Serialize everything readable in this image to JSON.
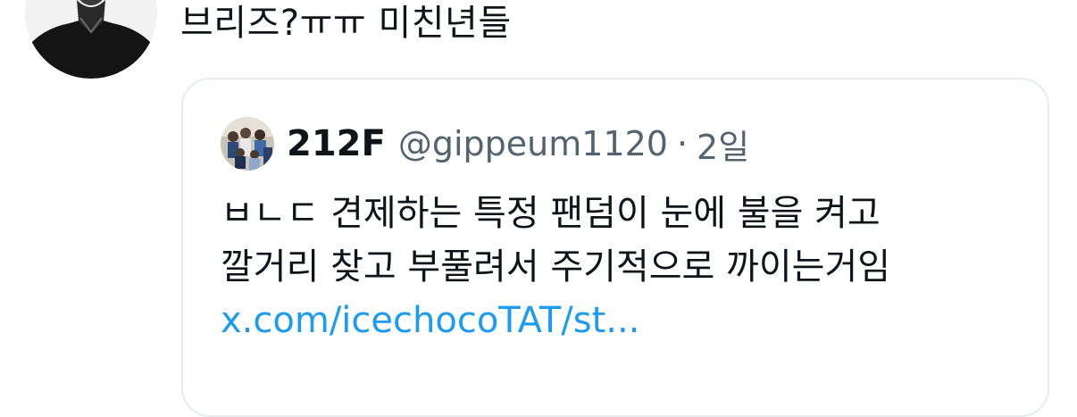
{
  "tweet": {
    "text": "브리즈?ㅠㅠ 미친년들"
  },
  "quote": {
    "author_name": "212F",
    "author_handle": "@gippeum1120",
    "separator": "·",
    "time": "2일",
    "lines": [
      "ㅂㄴㄷ 견제하는 특정 팬덤이 눈에 불을 켜고",
      "깔거리 찾고 부풀려서 주기적으로 까이는거임"
    ],
    "link": "x.com/icechocoTAT/st..."
  },
  "colors": {
    "text": "#0f1419",
    "secondary": "#536471",
    "link": "#1d9bf0",
    "border": "#e6ecf0"
  },
  "icons": {
    "user_avatar": "default-person-silhouette",
    "quote_avatar": "group-photo"
  }
}
